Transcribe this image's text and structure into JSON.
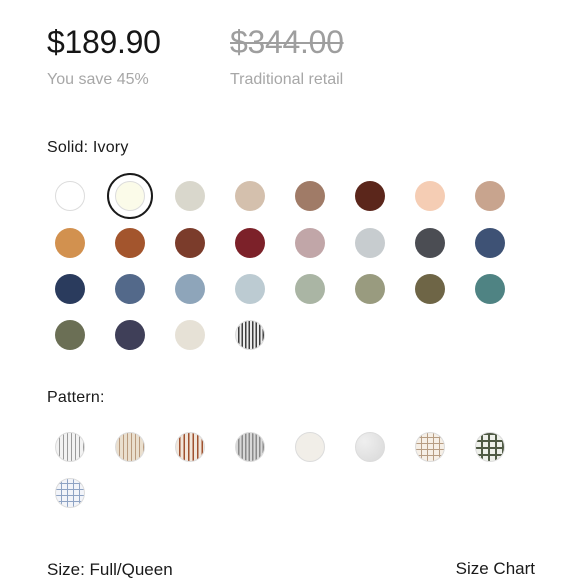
{
  "pricing": {
    "price": "$189.90",
    "savings": "You save 45%",
    "original_price": "$344.00",
    "original_label": "Traditional retail"
  },
  "solid": {
    "label": "Solid: Ivory",
    "selected": "Ivory",
    "colors": [
      "#ffffff",
      "#fbfbe9",
      "#d9d7cc",
      "#d4c0ad",
      "#a07b67",
      "#5b261b",
      "#f5cdb4",
      "#c8a48e",
      "#d2914f",
      "#a3552d",
      "#7b3c2b",
      "#7c2129",
      "#c1a6a8",
      "#c7cccf",
      "#4b4d53",
      "#3e5275",
      "#2a3b5d",
      "#53698a",
      "#8ea5ba",
      "#bccbd2",
      "#aab5a4",
      "#999b7f",
      "#6e6546",
      "#4f8383",
      "#6b6f55",
      "#3f3f58",
      "#e6e1d6",
      "stripe-charcoal"
    ]
  },
  "pattern": {
    "label": "Pattern:",
    "swatches": [
      "stripe-grey",
      "stripe-tan",
      "stripe-rust",
      "stripe-charcoal-light",
      "solid-cream",
      "texture-grey",
      "grid-tan",
      "grid-green",
      "grid-blue"
    ]
  },
  "size": {
    "label": "Size: Full/Queen",
    "chart_link": "Size Chart"
  }
}
